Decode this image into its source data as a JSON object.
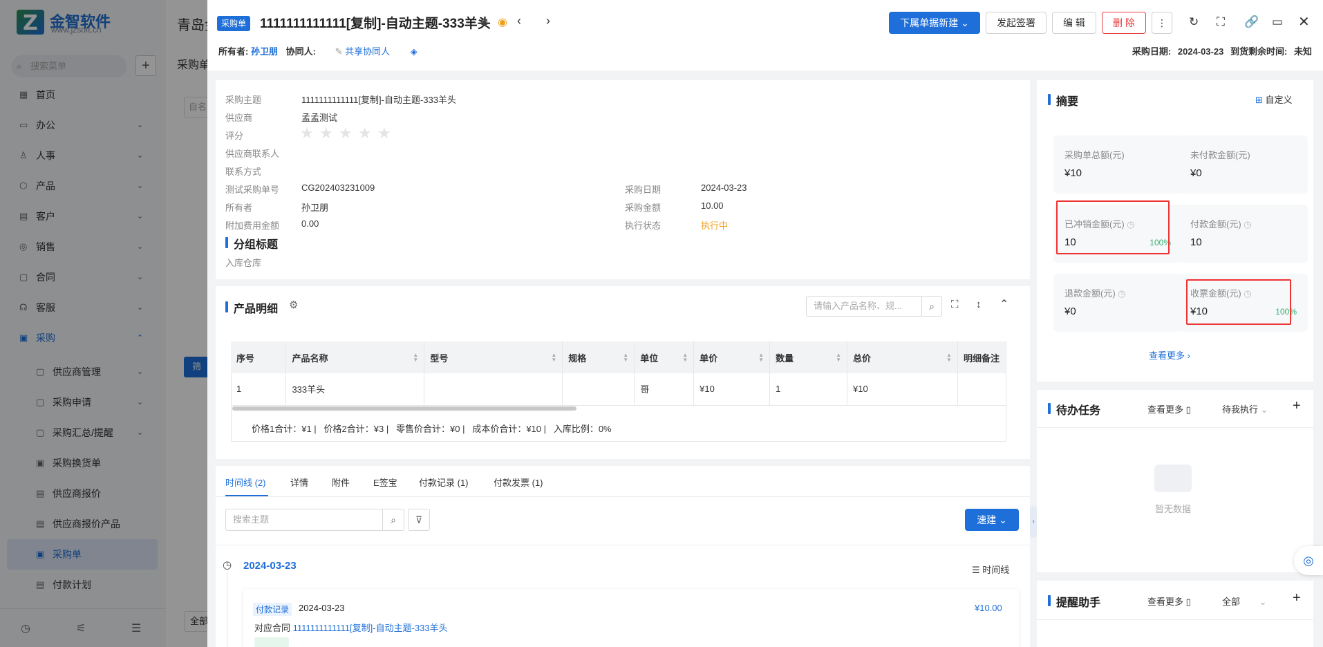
{
  "sidebar": {
    "brand_name": "金智软件",
    "brand_url": "www.jzsoft.cn",
    "search_placeholder": "搜索菜单",
    "add_symbol": "+",
    "items": [
      {
        "label": "首页",
        "icon": "home-icon",
        "glyph": "▦"
      },
      {
        "label": "办公",
        "icon": "office-icon",
        "glyph": "▭"
      },
      {
        "label": "人事",
        "icon": "people-icon",
        "glyph": "♙"
      },
      {
        "label": "产品",
        "icon": "product-icon",
        "glyph": "⬡"
      },
      {
        "label": "客户",
        "icon": "customer-icon",
        "glyph": "▤"
      },
      {
        "label": "销售",
        "icon": "sales-icon",
        "glyph": "◎"
      },
      {
        "label": "合同",
        "icon": "contract-icon",
        "glyph": "▢"
      },
      {
        "label": "客服",
        "icon": "service-icon",
        "glyph": "☊"
      },
      {
        "label": "采购",
        "icon": "purchase-icon",
        "glyph": "▣"
      }
    ],
    "sub_items": [
      {
        "label": "供应商管理",
        "icon": "supplier-icon",
        "glyph": "▢"
      },
      {
        "label": "采购申请",
        "icon": "request-icon",
        "glyph": "▢"
      },
      {
        "label": "采购汇总/提醒",
        "icon": "summary-icon",
        "glyph": "▢"
      },
      {
        "label": "采购换货单",
        "icon": "exchange-icon",
        "glyph": "▣"
      },
      {
        "label": "供应商报价",
        "icon": "quote-icon",
        "glyph": "▤"
      },
      {
        "label": "供应商报价产品",
        "icon": "quote-product-icon",
        "glyph": "▤"
      },
      {
        "label": "采购单",
        "icon": "order-icon",
        "glyph": "▣"
      },
      {
        "label": "付款计划",
        "icon": "payment-plan-icon",
        "glyph": "▤"
      }
    ]
  },
  "background": {
    "title": "青岛金",
    "subtitle": "采购单",
    "filter_btn": "筛",
    "bottom_btn": "全部",
    "search_fragment": "自名"
  },
  "drawer": {
    "tag": "采购单",
    "title": "1111111111111[复制]-自动主题-333羊头",
    "buttons": {
      "new_child": "下属单据新建",
      "sign": "发起签署",
      "edit": "编 辑",
      "delete": "删 除"
    },
    "owner_label": "所有者:",
    "owner_value": "孙卫朋",
    "collab_label": "协同人:",
    "share_label": "共享协同人",
    "purchase_date_label": "采购日期:",
    "purchase_date_value": "2024-03-23",
    "remaining_label": "到货剩余时间:",
    "remaining_value": "未知"
  },
  "details": {
    "fields_left": [
      {
        "label": "采购主题",
        "value": "1111111111111[复制]-自动主题-333羊头"
      },
      {
        "label": "供应商",
        "value": "孟孟测试"
      },
      {
        "label": "评分",
        "value": ""
      },
      {
        "label": "供应商联系人",
        "value": ""
      },
      {
        "label": "联系方式",
        "value": ""
      },
      {
        "label": "测试采购单号",
        "value": "CG202403231009"
      },
      {
        "label": "所有者",
        "value": "孙卫朋"
      },
      {
        "label": "附加费用金额",
        "value": "0.00"
      }
    ],
    "fields_right": [
      {
        "label": "采购日期",
        "value": "2024-03-23"
      },
      {
        "label": "采购金额",
        "value": "10.00"
      },
      {
        "label": "执行状态",
        "value": "执行中"
      }
    ],
    "rating": 0,
    "rating_max": 5,
    "group_title": "分组标题",
    "warehouse_label": "入库仓库"
  },
  "products": {
    "title": "产品明细",
    "search_placeholder": "请输入产品名称、规...",
    "columns": [
      "序号",
      "产品名称",
      "型号",
      "规格",
      "单位",
      "单价",
      "数量",
      "总价",
      "明细备注"
    ],
    "rows": [
      [
        "1",
        "333羊头",
        "",
        "",
        "哥",
        "¥10",
        "1",
        "¥10",
        ""
      ]
    ],
    "summary": "价格1合计：¥1 |   价格2合计：¥3 |   零售价合计：¥0 |   成本价合计：¥10 |   入库比例：0%"
  },
  "timeline": {
    "tabs": [
      "时间线 (2)",
      "详情",
      "附件",
      "E签宝",
      "付款记录 (1)",
      "付款发票 (1)"
    ],
    "search_placeholder": "搜索主题",
    "quick_create": "速建",
    "date": "2024-03-23",
    "view_label": "时间线",
    "entry_type": "付款记录",
    "entry_date": "2024-03-23",
    "entry_amount": "¥10.00",
    "entry_contract_label": "对应合同",
    "entry_contract_value": "1111111111111[复制]-自动主题-333羊头"
  },
  "summary": {
    "title": "摘要",
    "customize": "自定义",
    "metrics": [
      {
        "label": "采购单总额(元)",
        "value": "¥10",
        "pct": ""
      },
      {
        "label": "未付款金额(元)",
        "value": "¥0",
        "pct": ""
      },
      {
        "label": "已冲销金额(元)",
        "value": "10",
        "pct": "100%"
      },
      {
        "label": "付款金额(元)",
        "value": "10",
        "pct": ""
      },
      {
        "label": "退款金额(元)",
        "value": "¥0",
        "pct": ""
      },
      {
        "label": "收票金额(元)",
        "value": "¥10",
        "pct": "100%"
      }
    ],
    "more": "查看更多"
  },
  "tasks": {
    "title": "待办任务",
    "more": "查看更多",
    "filter": "待我执行",
    "empty": "暂无数据"
  },
  "reminder": {
    "title": "提醒助手",
    "more": "查看更多",
    "filter": "全部"
  },
  "colors": {
    "primary": "#1e6fd9",
    "danger": "#e63c3c",
    "status_orange": "#f0a020",
    "success_green": "#2fb36d"
  }
}
